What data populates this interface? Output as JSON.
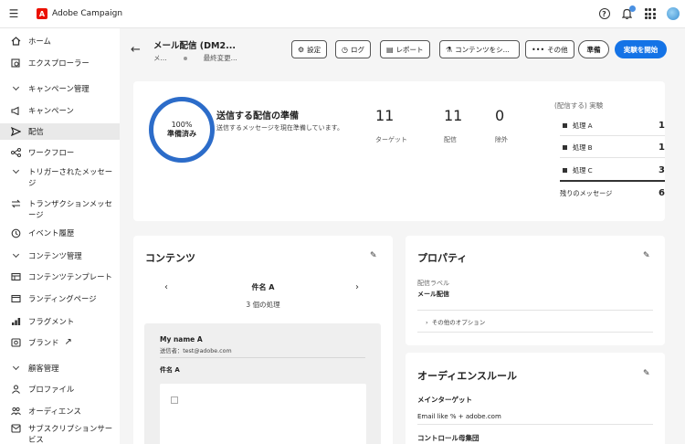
{
  "app": {
    "title": "Adobe Campaign",
    "logo_letter": "A"
  },
  "topbar": {
    "icons": [
      "help-icon",
      "bell-icon",
      "apps-icon",
      "avatar"
    ]
  },
  "sidebar": {
    "items": [
      {
        "label": "ホーム",
        "icon": "home-icon"
      },
      {
        "label": "エクスプローラー",
        "icon": "explorer-icon"
      },
      {
        "label": "キャンペーン管理",
        "icon": "chevron-down-icon",
        "section": true
      },
      {
        "label": "キャンペーン",
        "icon": "campaign-icon"
      },
      {
        "label": "配信",
        "icon": "send-icon",
        "active": true
      },
      {
        "label": "ワークフロー",
        "icon": "workflow-icon"
      },
      {
        "label": "トリガーされたメッセージ",
        "icon": "chevron-down-icon",
        "section": true
      },
      {
        "label": "トランザクションメッセージ",
        "icon": "transaction-icon"
      },
      {
        "label": "イベント履歴",
        "icon": "history-icon"
      },
      {
        "label": "コンテンツ管理",
        "icon": "chevron-down-icon",
        "section": true
      },
      {
        "label": "コンテンツテンプレート",
        "icon": "template-icon"
      },
      {
        "label": "ランディングページ",
        "icon": "landing-page-icon"
      },
      {
        "label": "フラグメント",
        "icon": "fragment-icon"
      },
      {
        "label": "ブランド",
        "icon": "brand-icon",
        "external": "↗"
      },
      {
        "label": "顧客管理",
        "icon": "chevron-down-icon",
        "section": true
      },
      {
        "label": "プロファイル",
        "icon": "profile-icon"
      },
      {
        "label": "オーディエンス",
        "icon": "audience-icon"
      },
      {
        "label": "サブスクリプションサービス",
        "icon": "subscription-icon"
      }
    ]
  },
  "header": {
    "title": "メール配信 (DM2...",
    "sub_left": "メ...",
    "sub_right": "最終変更...",
    "buttons": {
      "settings": "設定",
      "log": "ログ",
      "report": "レポート",
      "content": "コンテンツをシ...",
      "more": "その他",
      "prepare": "準備",
      "start": "実験を開始"
    }
  },
  "summary": {
    "progress_pct": "100%",
    "progress_label": "準備済み",
    "title": "送信する配信の準備",
    "subtitle": "送信するメッセージを現在準備しています。",
    "stats": [
      {
        "value": "11",
        "caption": "ターゲット"
      },
      {
        "value": "11",
        "caption": "配信"
      },
      {
        "value": "0",
        "caption": "除外"
      }
    ],
    "experiment": {
      "title": "(配信する) 実験",
      "rows": [
        {
          "label": "処理 A",
          "value": "1"
        },
        {
          "label": "処理 B",
          "value": "1"
        },
        {
          "label": "処理 C",
          "value": "3"
        }
      ],
      "remaining_label": "残りのメッセージ",
      "remaining_value": "6"
    }
  },
  "content": {
    "title": "コンテンツ",
    "subject_title": "件名 A",
    "subject_sub": "3 個の処理",
    "preview": {
      "name": "My name A",
      "from": "送信者：test@adobe.com",
      "subject": "件名 A"
    }
  },
  "properties": {
    "title": "プロパティ",
    "label_caption": "配信ラベル",
    "label_value": "メール配信",
    "other_options": "その他のオプション"
  },
  "audience": {
    "title": "オーディエンスルール",
    "main_target_label": "メインターゲット",
    "main_target_value": "Email like % + adobe.com",
    "control_label": "コントロール母集団"
  }
}
